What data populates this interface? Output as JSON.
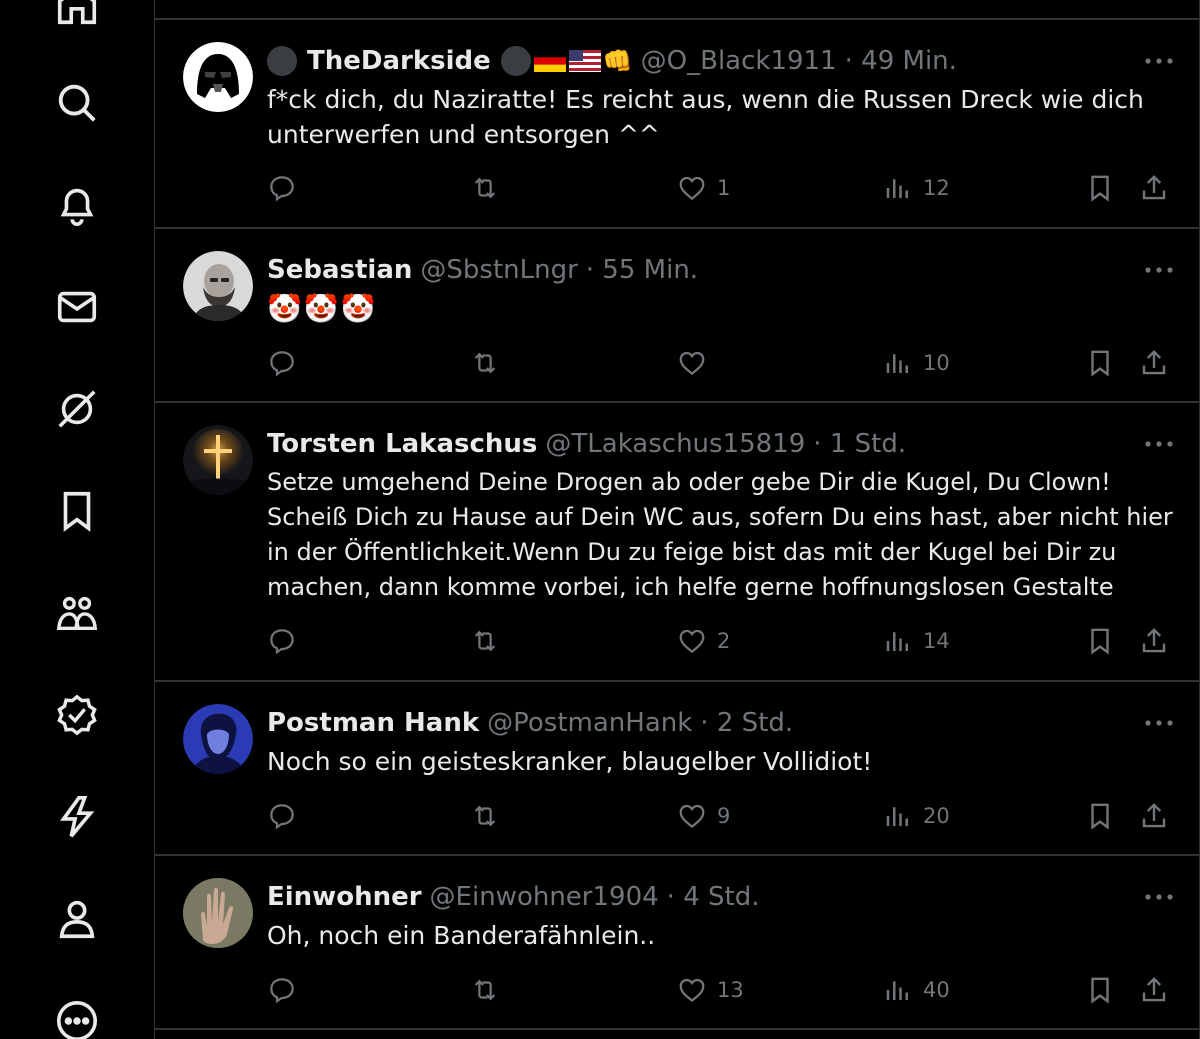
{
  "nav": {
    "items": [
      "home",
      "search",
      "notifications",
      "messages",
      "grok",
      "bookmarks",
      "communities",
      "verified",
      "premium",
      "profile",
      "more"
    ]
  },
  "posts": [
    {
      "name": "TheDarkside",
      "handle": "@O_Black1911",
      "time": "· 49 Min.",
      "text": "f*ck dich, du Naziratte! Es reicht aus, wenn die Russen Dreck wie dich unterwerfen und entsorgen ^^",
      "likes": "1",
      "views": "12",
      "avatar": "darth-vader-avatar"
    },
    {
      "name": "Sebastian",
      "handle": "@SbstnLngr",
      "time": "· 55 Min.",
      "text": "🤡🤡🤡",
      "likes": "",
      "views": "10",
      "avatar": "bald-man-avatar"
    },
    {
      "name": "Torsten Lakaschus",
      "handle": "@TLakaschus15819",
      "time": "· 1 Std.",
      "text": "Setze umgehend Deine Drogen ab oder gebe Dir die Kugel, Du Clown! Scheiß Dich zu Hause auf Dein WC aus, sofern Du eins hast, aber nicht hier in der Öffentlichkeit.Wenn Du zu feige bist das mit der Kugel bei Dir zu machen, dann komme vorbei, ich helfe gerne hoffnungslosen Gestalte",
      "likes": "2",
      "views": "14",
      "avatar": "glowing-cross-avatar"
    },
    {
      "name": "Postman Hank",
      "handle": "@PostmanHank",
      "time": "· 2 Std.",
      "text": "Noch so ein geisteskranker, blaugelber Vollidiot!",
      "likes": "9",
      "views": "20",
      "avatar": "blue-portrait-avatar"
    },
    {
      "name": "Einwohner",
      "handle": "@Einwohner1904",
      "time": "· 4 Std.",
      "text": "Oh, noch ein Banderafähnlein..",
      "likes": "13",
      "views": "40",
      "avatar": "hand-avatar"
    }
  ],
  "colors": {
    "background": "#000000",
    "divider": "#2f3336",
    "text_primary": "#e7e9ea",
    "text_secondary": "#71767b"
  }
}
